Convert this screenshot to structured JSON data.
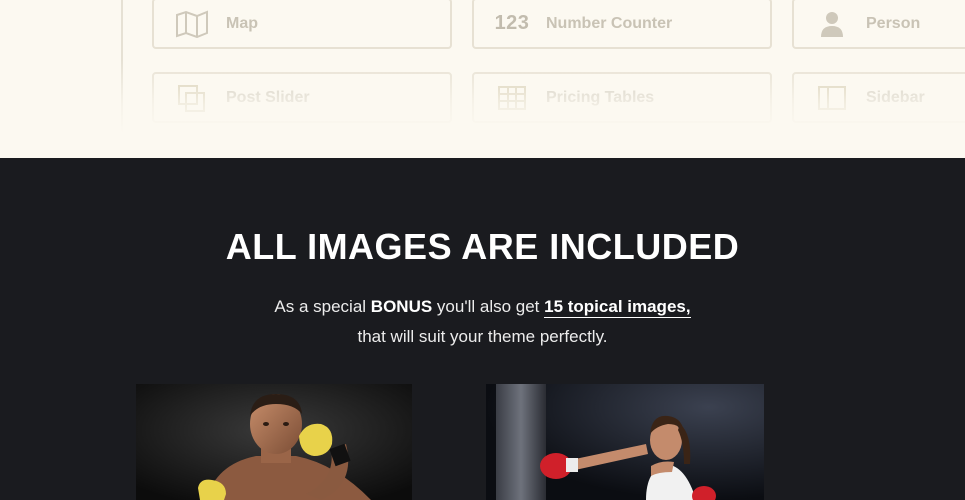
{
  "modules": [
    {
      "label": "Map",
      "icon": "map-icon"
    },
    {
      "label": "Number Counter",
      "icon": "number-counter-icon",
      "icon_text": "123"
    },
    {
      "label": "Person",
      "icon": "person-icon"
    },
    {
      "label": "Post Slider",
      "icon": "post-slider-icon"
    },
    {
      "label": "Pricing Tables",
      "icon": "pricing-table-icon"
    },
    {
      "label": "Sidebar",
      "icon": "sidebar-icon"
    }
  ],
  "section": {
    "headline": "ALL IMAGES ARE INCLUDED",
    "line1_pre": "As a special ",
    "line1_bonus": "BONUS",
    "line1_mid": " you'll also get ",
    "line1_link": "15 topical images",
    "line1_post": ",",
    "line2": "that will suit your theme perfectly."
  },
  "colors": {
    "cream": "#fcf9f1",
    "dark": "#1a1b1f",
    "glove_yellow": "#e8d24a",
    "glove_red": "#d0202a"
  }
}
